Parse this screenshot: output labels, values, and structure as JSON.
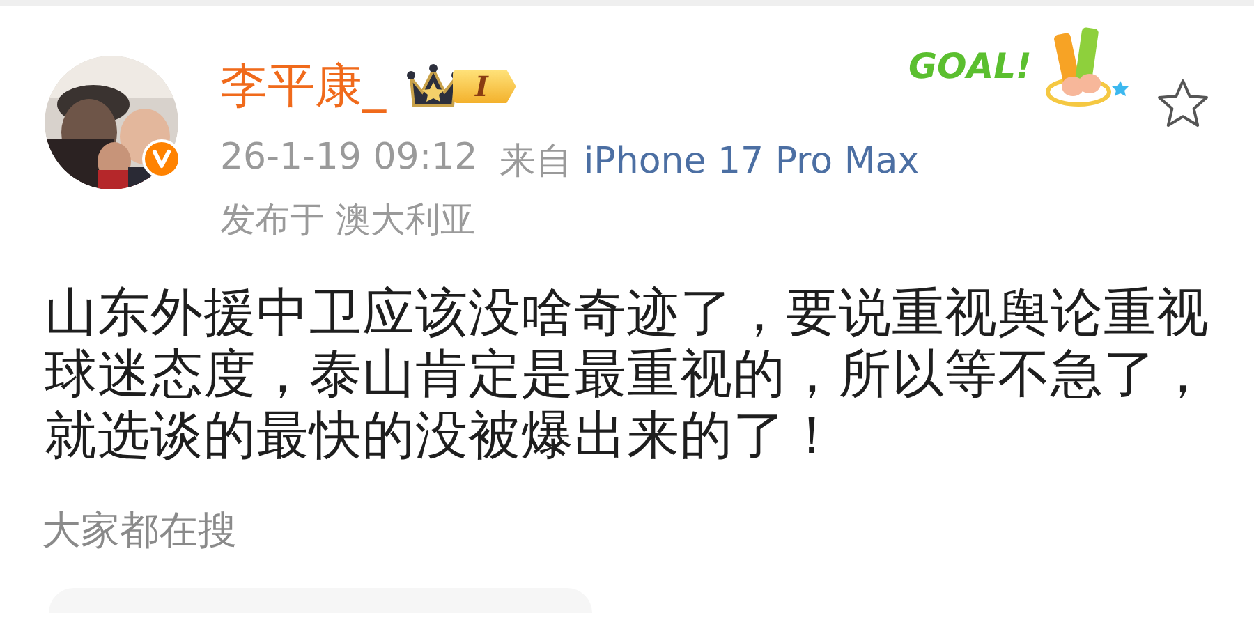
{
  "post": {
    "author": {
      "name": "李平康_",
      "level_badge": "I",
      "verified": true
    },
    "time": "26-1-19 09:12",
    "source_prefix": "来自",
    "source": "iPhone 17 Pro Max",
    "location": "发布于 澳大利亚",
    "sticker": {
      "text": "GOAL!"
    },
    "favorited": false,
    "text": "山东外援中卫应该没啥奇迹了，要说重视舆论重视球迷态度，泰山肯定是最重视的，所以等不急了，就选谈的最快的没被爆出来的了！"
  },
  "trending": {
    "title": "大家都在搜"
  }
}
